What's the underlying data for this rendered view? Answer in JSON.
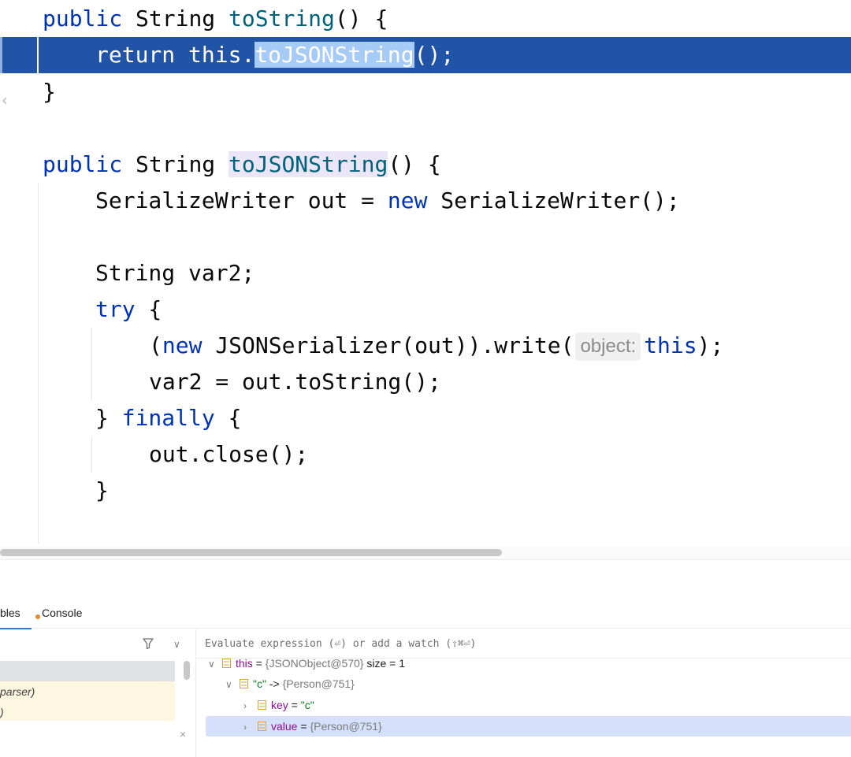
{
  "editor": {
    "line1": {
      "kw": "public",
      "type": " String ",
      "name": "toString",
      "rest": "() {"
    },
    "line2": {
      "kw": "return",
      "pre": " this.",
      "sel": "toJSONString",
      "rest": "();"
    },
    "line3": {
      "text": "}"
    },
    "line5": {
      "kw": "public",
      "type": " String ",
      "name": "toJSONString",
      "rest": "() {"
    },
    "line6": {
      "a": "SerializeWriter out = ",
      "kw": "new",
      "b": " SerializeWriter();"
    },
    "line8": {
      "text": "String var2;"
    },
    "line9": {
      "kw": "try",
      "rest": " {"
    },
    "line10": {
      "a": "(",
      "kw": "new",
      "b": " JSONSerializer(out)).write(",
      "hint": "object:",
      "kw2": "this",
      "c": ");"
    },
    "line11": {
      "text": "var2 = out.toString();"
    },
    "line12": {
      "a": "} ",
      "kw": "finally",
      "b": " {"
    },
    "line13": {
      "text": "out.close();"
    },
    "line14": {
      "text": "}"
    }
  },
  "panel": {
    "tabs": [
      {
        "label": "bles"
      },
      {
        "label": "Console"
      }
    ],
    "frames": [
      {
        "label": ""
      },
      {
        "label": "parser)"
      },
      {
        "label": ")"
      }
    ],
    "close_symbol": "×",
    "eval_placeholder": "Evaluate expression (⏎) or add a watch (⇧⌘⏎)",
    "variables": [
      {
        "arrow": "∨",
        "name": "this",
        "eq": " = ",
        "value": "{JSONObject@570}",
        "extra": "  size = 1"
      },
      {
        "arrow": "∨",
        "name": "\"c\"",
        "eq": " -> ",
        "value": "{Person@751}",
        "extra": ""
      },
      {
        "arrow": "›",
        "name": "key",
        "eq": " = ",
        "value": "\"c\"",
        "extra": ""
      },
      {
        "arrow": "›",
        "name": "value",
        "eq": " = ",
        "value": "{Person@751}",
        "extra": ""
      }
    ]
  },
  "colors": {
    "keyword": "#0033b3",
    "method": "#00627a",
    "execution_line": "#2154a7",
    "selection": "#a6cbf7",
    "string": "#067d17"
  },
  "icons": [
    "filter-icon",
    "chevron-down-icon",
    "variable-icon",
    "expand-arrow-icon",
    "collapse-arrow-icon"
  ]
}
